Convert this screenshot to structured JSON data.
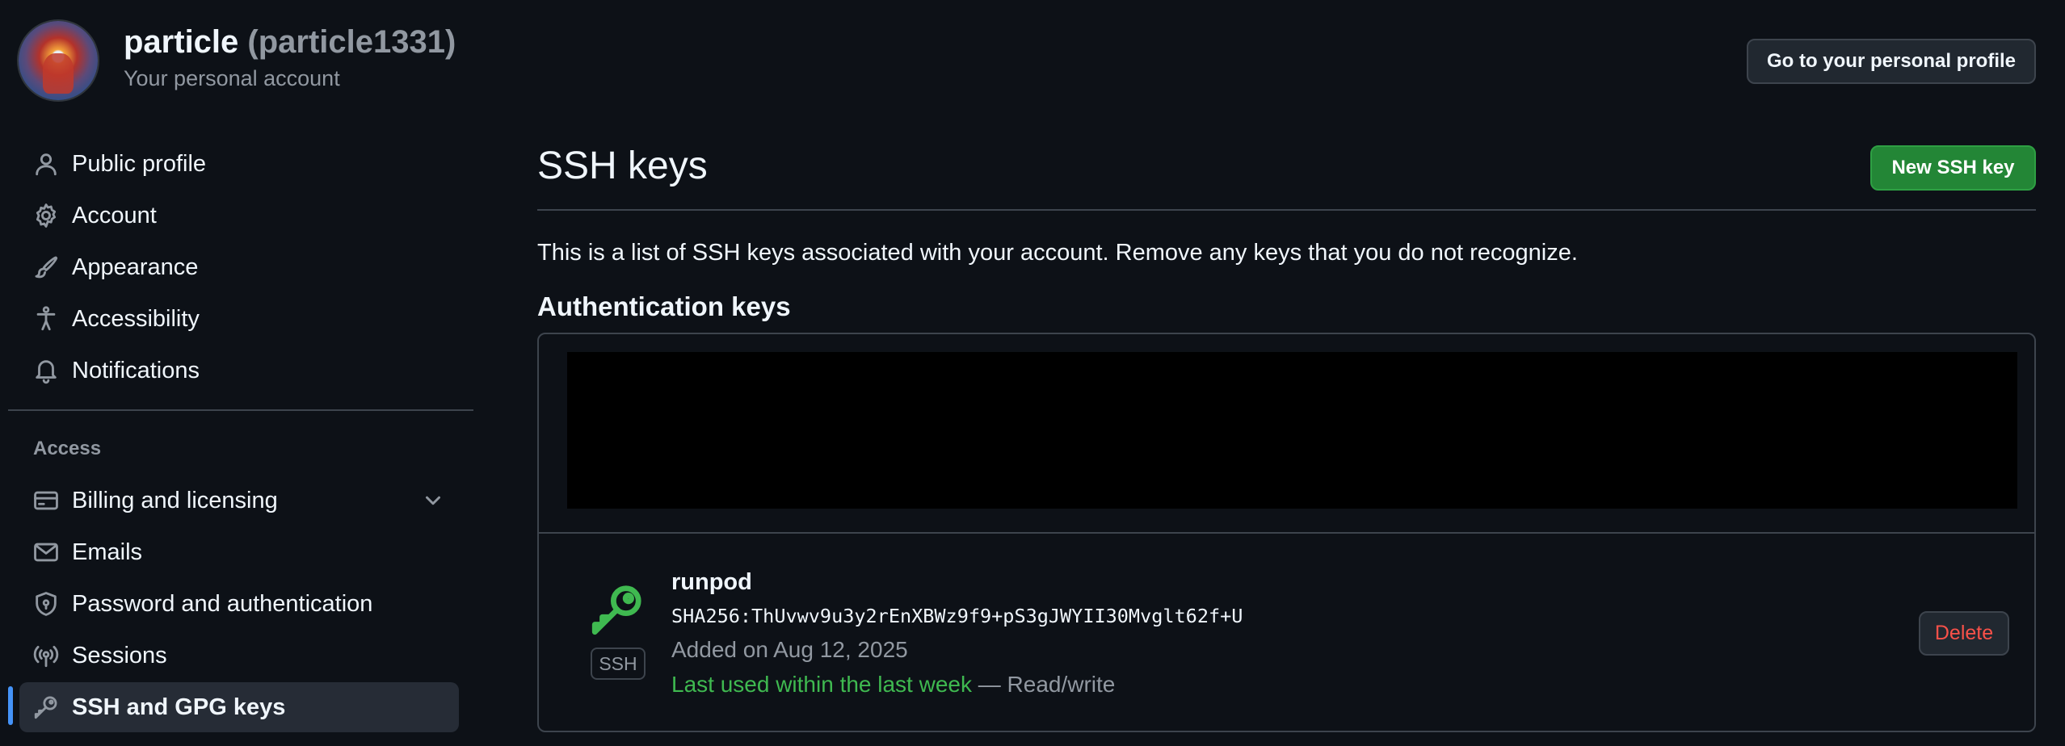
{
  "header": {
    "display_name": "particle",
    "handle": "(particle1331)",
    "subtitle": "Your personal account",
    "profile_button": "Go to your personal profile"
  },
  "sidebar": {
    "items": [
      {
        "label": "Public profile",
        "icon": "person-icon"
      },
      {
        "label": "Account",
        "icon": "gear-icon"
      },
      {
        "label": "Appearance",
        "icon": "paintbrush-icon"
      },
      {
        "label": "Accessibility",
        "icon": "accessibility-icon"
      },
      {
        "label": "Notifications",
        "icon": "bell-icon"
      }
    ],
    "access_heading": "Access",
    "access_items": [
      {
        "label": "Billing and licensing",
        "icon": "credit-card-icon"
      },
      {
        "label": "Emails",
        "icon": "mail-icon"
      },
      {
        "label": "Password and authentication",
        "icon": "shield-lock-icon"
      },
      {
        "label": "Sessions",
        "icon": "broadcast-icon"
      },
      {
        "label": "SSH and GPG keys",
        "icon": "key-icon"
      }
    ],
    "active_item": "SSH and GPG keys",
    "accent_color": "#4493f8"
  },
  "main": {
    "title": "SSH keys",
    "new_button": "New SSH key",
    "description": "This is a list of SSH keys associated with your account. Remove any keys that you do not recognize.",
    "section_title": "Authentication keys",
    "keys": [
      {
        "title": "runpod",
        "fingerprint": "SHA256:ThUvwv9u3y2rEnXBWz9f9+pS3gJWYII30Mvglt62f+U",
        "added": "Added on Aug 12, 2025",
        "last_used": "Last used within the last week",
        "access": " — Read/write",
        "badge": "SSH",
        "delete_label": "Delete"
      }
    ]
  },
  "colors": {
    "background": "#0d1117",
    "success": "#238636",
    "danger": "#f85149",
    "used_text": "#3fb950"
  }
}
